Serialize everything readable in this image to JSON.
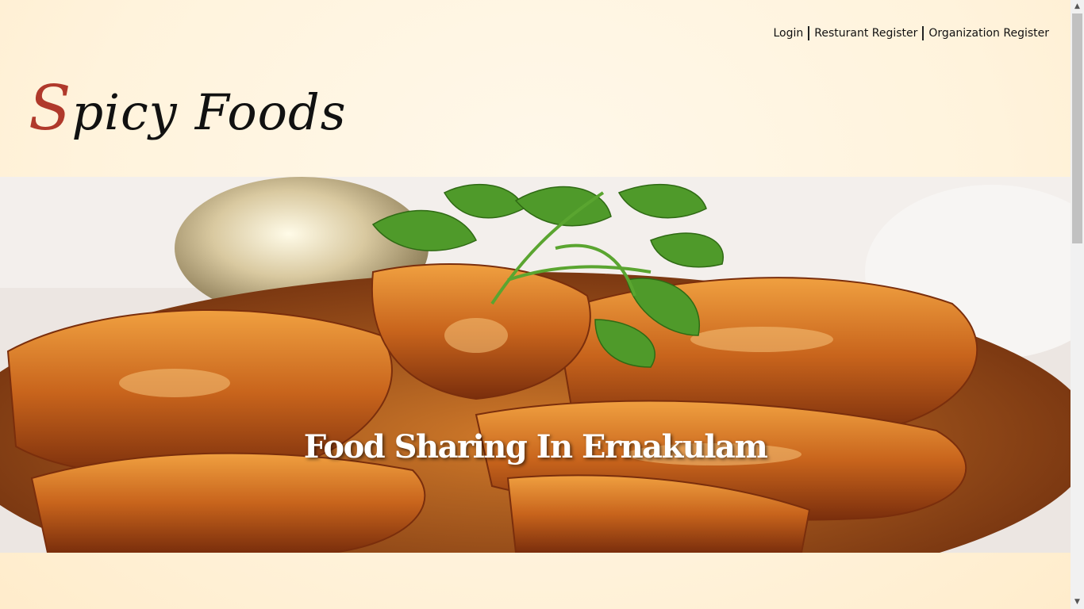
{
  "nav": {
    "login": "Login",
    "restaurant_register": "Resturant Register",
    "organization_register": "Organization Register"
  },
  "logo": {
    "cap": "S",
    "rest1": "picy",
    "word2": "Foods"
  },
  "hero": {
    "title": "Food Sharing In Ernakulam",
    "image_subject": "prawn-dish-image"
  },
  "colors": {
    "logo_accent": "#b0392b",
    "background": "#fff3dc"
  }
}
